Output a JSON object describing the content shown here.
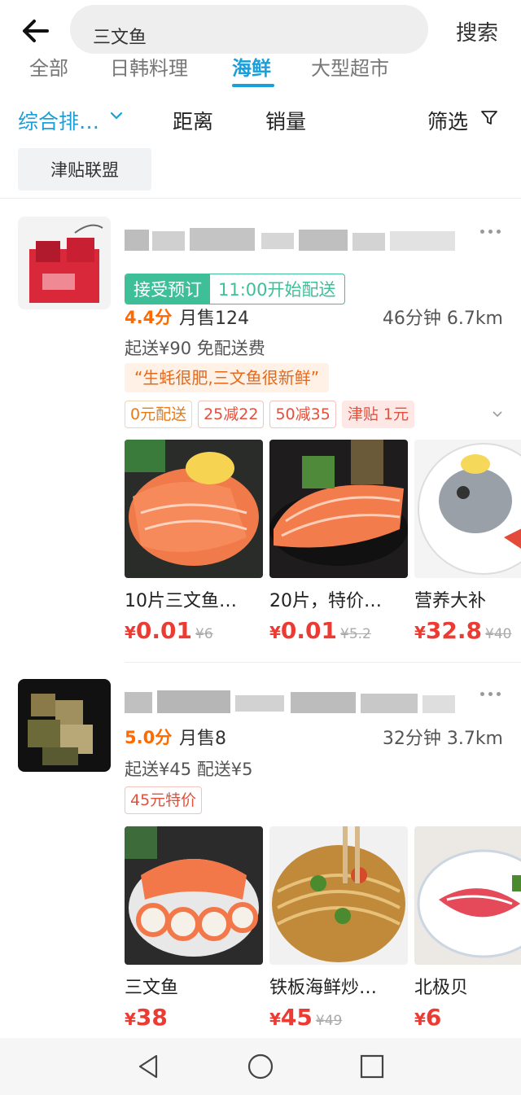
{
  "search": {
    "query": "三文鱼",
    "button": "搜索"
  },
  "tabs": [
    {
      "label": "全部",
      "active": false
    },
    {
      "label": "日韩料理",
      "active": false
    },
    {
      "label": "海鲜",
      "active": true
    },
    {
      "label": "大型超市",
      "active": false
    }
  ],
  "sort": {
    "comprehensive": "综合排…",
    "distance": "距离",
    "sales": "销量",
    "filter": "筛选"
  },
  "chip": "津贴联盟",
  "shops": [
    {
      "preorder_label": "接受预订",
      "delivery_start": "11:00开始配送",
      "rating": "4.4分",
      "monthly_sales": "月售124",
      "time_distance": "46分钟  6.7km",
      "fees": "起送¥90  免配送费",
      "review_quote": "“生蚝很肥,三文鱼很新鲜”",
      "promos": [
        "0元配送",
        "25减22",
        "50减35",
        "津贴 1元"
      ],
      "dishes": [
        {
          "name": "10片三文鱼…",
          "currency": "¥",
          "price": "0.01",
          "orig": "¥6"
        },
        {
          "name": "20片，特价…",
          "currency": "¥",
          "price": "0.01",
          "orig": "¥5.2"
        },
        {
          "name": "营养大补",
          "currency": "¥",
          "price": "32.8",
          "orig": "¥40"
        }
      ]
    },
    {
      "rating": "5.0分",
      "monthly_sales": "月售8",
      "time_distance": "32分钟  3.7km",
      "fees": "起送¥45  配送¥5",
      "promos": [
        "45元特价"
      ],
      "dishes": [
        {
          "name": "三文鱼",
          "currency": "¥",
          "price": "38",
          "orig": ""
        },
        {
          "name": "铁板海鲜炒…",
          "currency": "¥",
          "price": "45",
          "orig": "¥49"
        },
        {
          "name": "北极贝",
          "currency": "¥",
          "price": "6",
          "orig": ""
        }
      ]
    }
  ],
  "colors": {
    "accent": "#1a9fdb",
    "price": "#ec3b33",
    "rating": "#ff6a00",
    "preorder": "#3ebf97"
  }
}
